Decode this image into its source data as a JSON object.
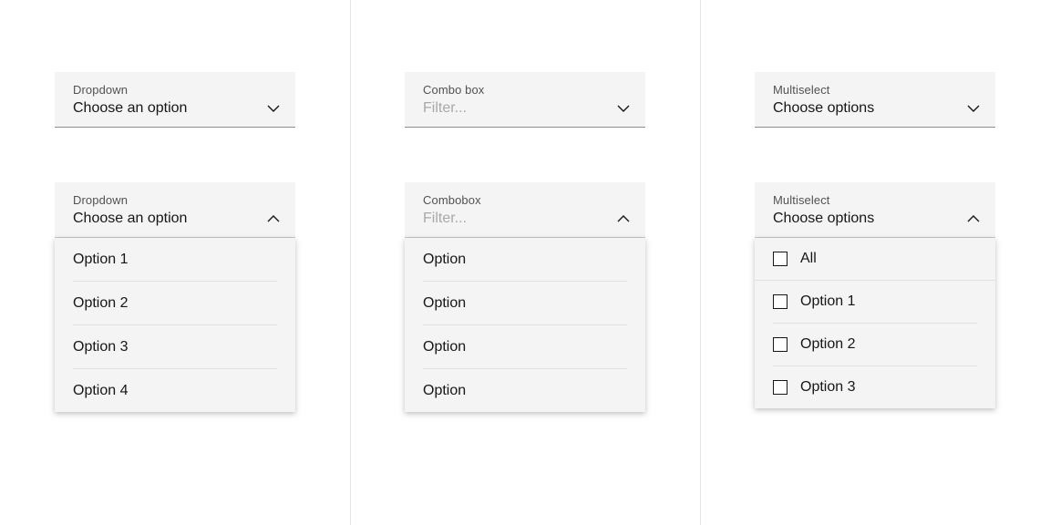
{
  "dropdown_closed": {
    "label": "Dropdown",
    "value": "Choose an option"
  },
  "dropdown_open": {
    "label": "Dropdown",
    "value": "Choose an option",
    "options": [
      "Option 1",
      "Option 2",
      "Option 3",
      "Option 4"
    ]
  },
  "combobox_closed": {
    "label": "Combo box",
    "placeholder": "Filter..."
  },
  "combobox_open": {
    "label": "Combobox",
    "placeholder": "Filter...",
    "options": [
      "Option",
      "Option",
      "Option",
      "Option"
    ]
  },
  "multiselect_closed": {
    "label": "Multiselect",
    "value": "Choose options"
  },
  "multiselect_open": {
    "label": "Multiselect",
    "value": "Choose options",
    "options": [
      "All",
      "Option 1",
      "Option 2",
      "Option 3"
    ]
  }
}
